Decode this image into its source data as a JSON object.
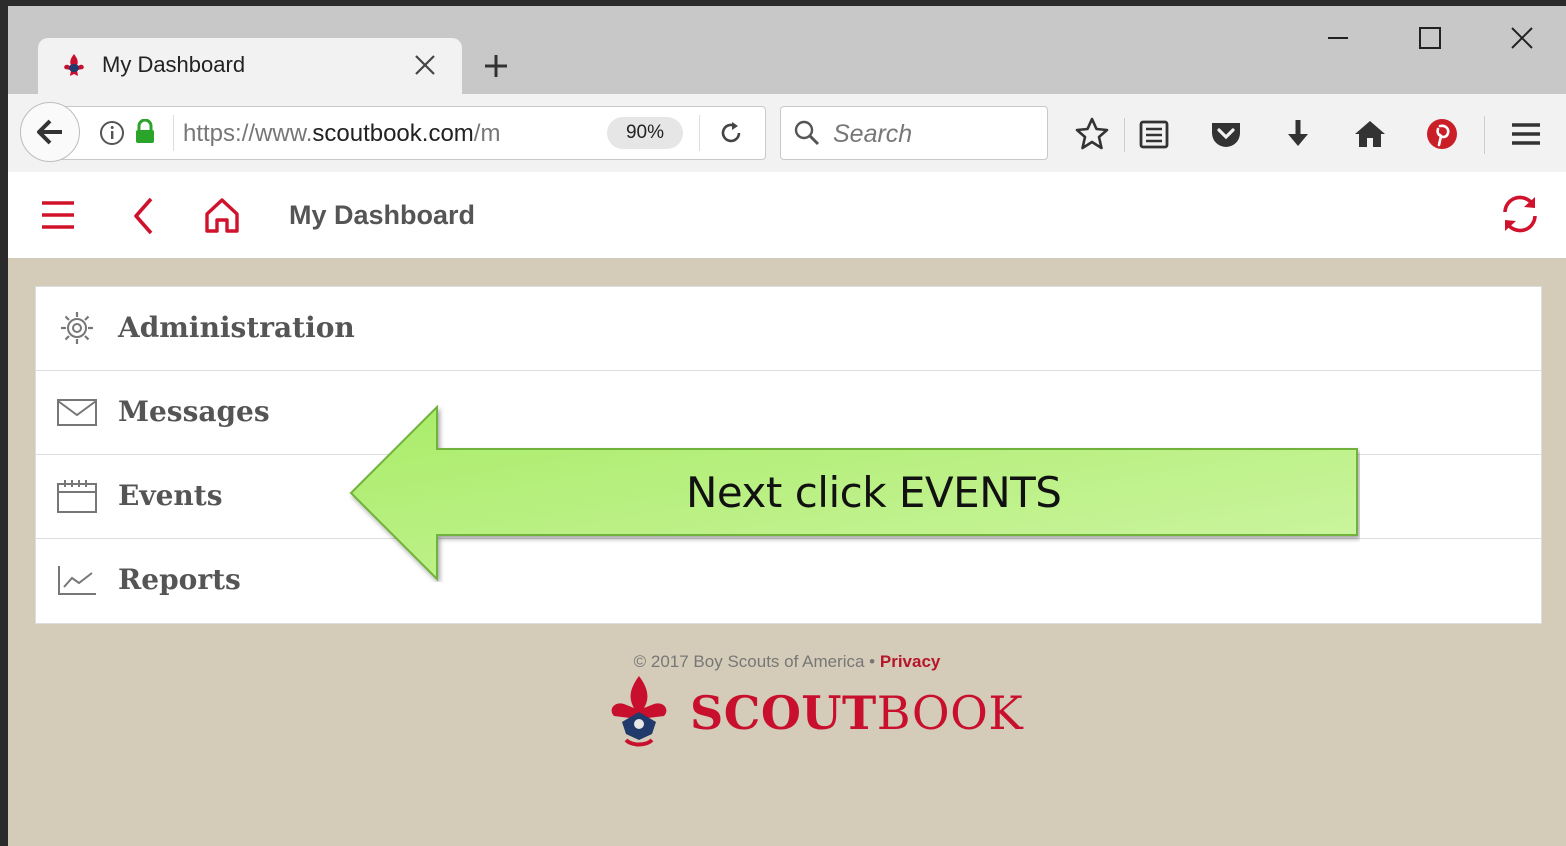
{
  "browser": {
    "tab_title": "My Dashboard",
    "url_prefix": "https://www.",
    "url_domain": "scoutbook.com",
    "url_suffix": "/m",
    "zoom": "90%",
    "search_placeholder": "Search"
  },
  "app": {
    "title": "My Dashboard"
  },
  "menu": {
    "items": [
      {
        "label": "Administration",
        "icon": "gear-icon"
      },
      {
        "label": "Messages",
        "icon": "envelope-icon"
      },
      {
        "label": "Events",
        "icon": "calendar-icon"
      },
      {
        "label": "Reports",
        "icon": "chart-icon"
      }
    ]
  },
  "callout": {
    "text": "Next click EVENTS"
  },
  "footer": {
    "copyright": "© 2017 Boy Scouts of America • ",
    "privacy": "Privacy",
    "brand_bold": "SCOUT",
    "brand_light": "BOOK"
  },
  "colors": {
    "accent": "#c8102e",
    "page_bg": "#d4ccb8",
    "callout_green": "#b6f27a"
  }
}
